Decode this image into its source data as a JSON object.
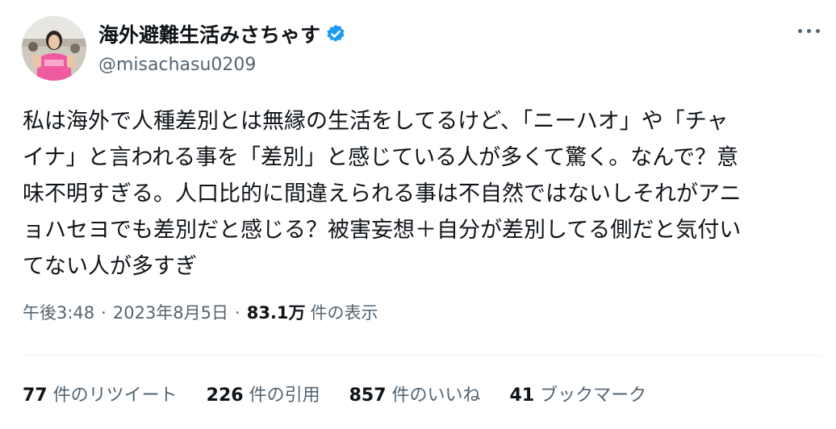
{
  "author": {
    "display_name": "海外避難生活みさちゃす",
    "handle": "@misachasu0209",
    "verified": true,
    "verified_color": "#1d9bf0"
  },
  "tweet": {
    "lines": [
      "私は海外で人種差別とは無縁の生活をしてるけど、「ニーハオ」や「チャ",
      "イナ」と言われる事を「差別」と感じている人が多くて驚く。なんで？意",
      "味不明すぎる。人口比的に間違えられる事は不自然ではないしそれがアニ",
      "ョハセヨでも差別だと感じる？被害妄想＋自分が差別してる側だと気付い",
      "てない人が多すぎ"
    ]
  },
  "meta": {
    "time": "午後3:48",
    "separator": "·",
    "date": "2023年8月5日",
    "views_count": "83.1万",
    "views_label": "件の表示"
  },
  "stats": {
    "retweets": {
      "count": "77",
      "label": "件のリツイート"
    },
    "quotes": {
      "count": "226",
      "label": "件の引用"
    },
    "likes": {
      "count": "857",
      "label": "件のいいね"
    },
    "bookmarks": {
      "count": "41",
      "label": "ブックマーク"
    }
  },
  "icons": {
    "more": "more-horizontal-icon",
    "verified": "verified-badge-icon"
  }
}
